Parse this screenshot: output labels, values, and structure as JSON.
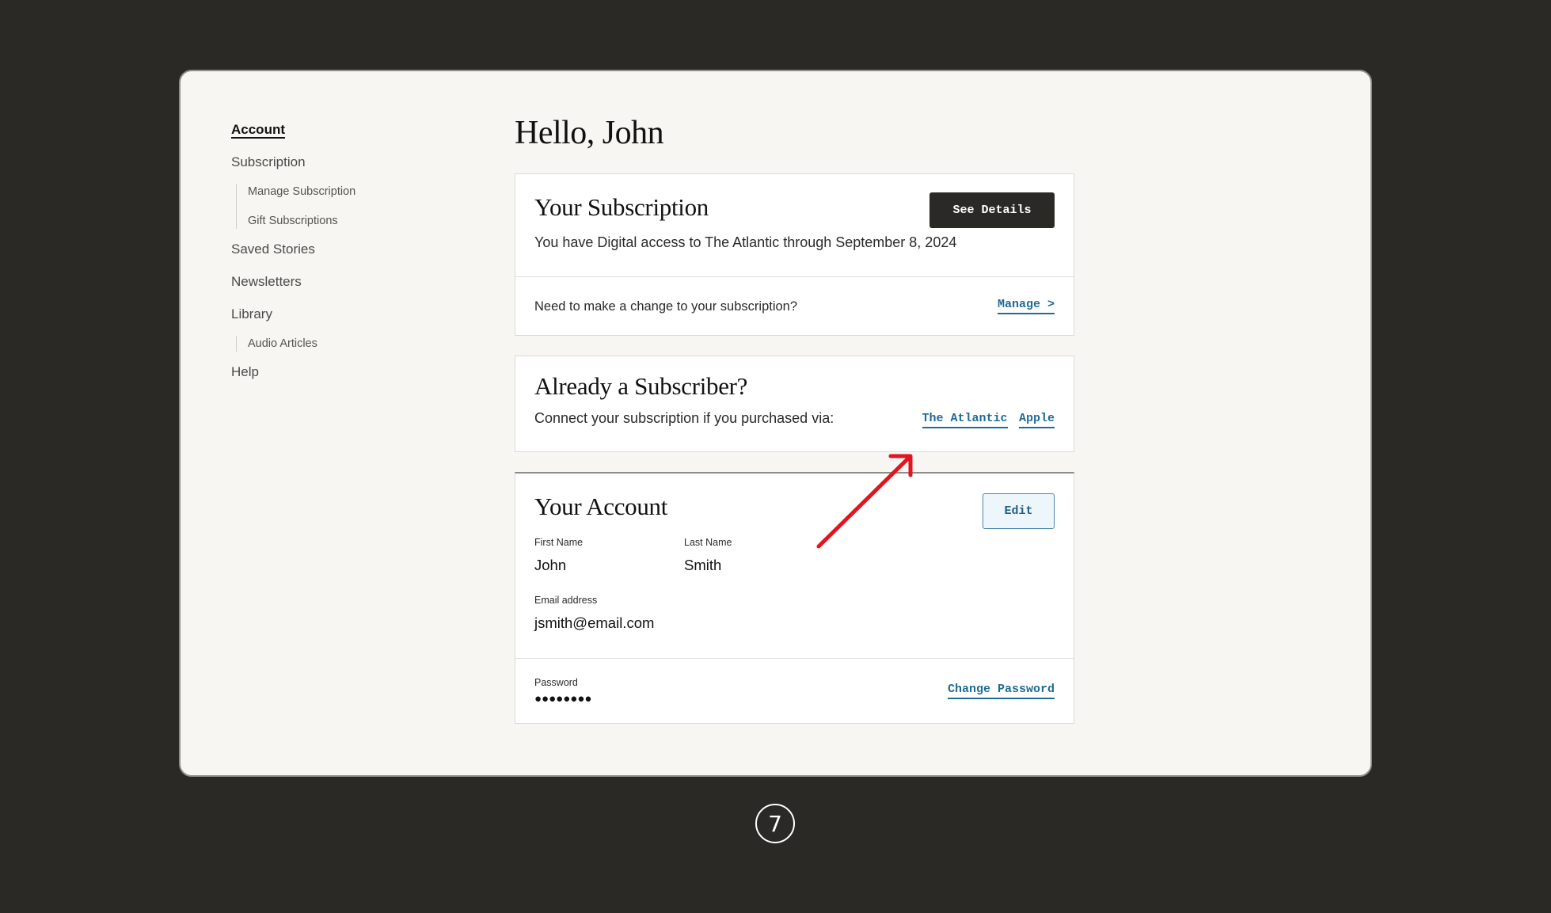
{
  "sidebar": {
    "items": [
      {
        "label": "Account",
        "active": true
      },
      {
        "label": "Subscription"
      },
      {
        "label": "Manage Subscription"
      },
      {
        "label": "Gift Subscriptions"
      },
      {
        "label": "Saved Stories"
      },
      {
        "label": "Newsletters"
      },
      {
        "label": "Library"
      },
      {
        "label": "Audio Articles"
      },
      {
        "label": "Help"
      }
    ]
  },
  "main": {
    "greeting": "Hello, John",
    "subscription": {
      "title": "Your Subscription",
      "details_button": "See Details",
      "access_text": "You have Digital access to The Atlantic through September 8, 2024",
      "change_prompt": "Need to make a change to your subscription?",
      "manage_link": "Manage >"
    },
    "already_subscriber": {
      "title": "Already a Subscriber?",
      "connect_text": "Connect your subscription if you purchased via:",
      "links": [
        "The Atlantic",
        "Apple"
      ]
    },
    "account": {
      "title": "Your Account",
      "edit_button": "Edit",
      "first_name_label": "First Name",
      "first_name": "John",
      "last_name_label": "Last Name",
      "last_name": "Smith",
      "email_label": "Email address",
      "email": "jsmith@email.com",
      "password_label": "Password",
      "password_mask": "●●●●●●●●",
      "change_password_link": "Change Password"
    }
  },
  "annotation": {
    "arrow_color": "#e3141f"
  },
  "step_badge": "7",
  "colors": {
    "background": "#2a2926",
    "panel": "#f7f6f3",
    "link": "#1f6a96",
    "dark_button": "#2a2926"
  }
}
